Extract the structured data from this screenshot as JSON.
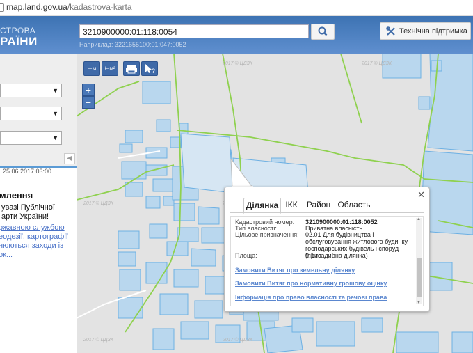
{
  "browser": {
    "url_host": "map.land.gov.ua",
    "url_path": "/kadastrova-karta"
  },
  "header": {
    "logo_line1": "СТРОВА",
    "logo_line2": "РАЇНИ",
    "search_value": "3210900000:01:118:0054",
    "search_hint": "Наприклад: 3221655100:01:047:0052",
    "support_label": "Технічна підтримка"
  },
  "sidebar": {
    "date": "25.06.2017 03:00",
    "news_title": "млення",
    "news_line1": "увазі Публічної",
    "news_line2": "арти України!",
    "link_line1": "ржавною службою",
    "link_line2": "еодезії, картографії",
    "link_line3": "нюються заходи із",
    "link_line4": "ок..."
  },
  "map": {
    "watermark": "2017 © ЦДЗК",
    "tools": [
      "⊢м",
      "⊢м²",
      "print",
      "?"
    ],
    "zoom_in": "+",
    "zoom_out": "−"
  },
  "popup": {
    "tabs": [
      "Ділянка",
      "ІКК",
      "Район",
      "Область"
    ],
    "active_tab": "Ділянка",
    "fields": [
      {
        "label": "Кадастровий номер:",
        "value": "3210900000:01:118:0052"
      },
      {
        "label": "Тип власності:",
        "value": "Приватна власність"
      },
      {
        "label": "Цільове призначення:",
        "value": "02.01 Для будівництва і обслуговування житлового будинку, господарських будівель і споруд (присадибна ділянка)"
      },
      {
        "label": "Площа:",
        "value": "0.1 га"
      }
    ],
    "links": [
      "Замовити Витяг про земельну ділянку",
      "Замовити Витяг про нормативну грошову оцінку",
      "Інформація про право власності та речові права"
    ]
  },
  "colors": {
    "header": "#4a7fc0",
    "parcel_fill": "#b9d7ee",
    "parcel_stroke": "#6db0e3",
    "boundary": "#8fd14f"
  }
}
